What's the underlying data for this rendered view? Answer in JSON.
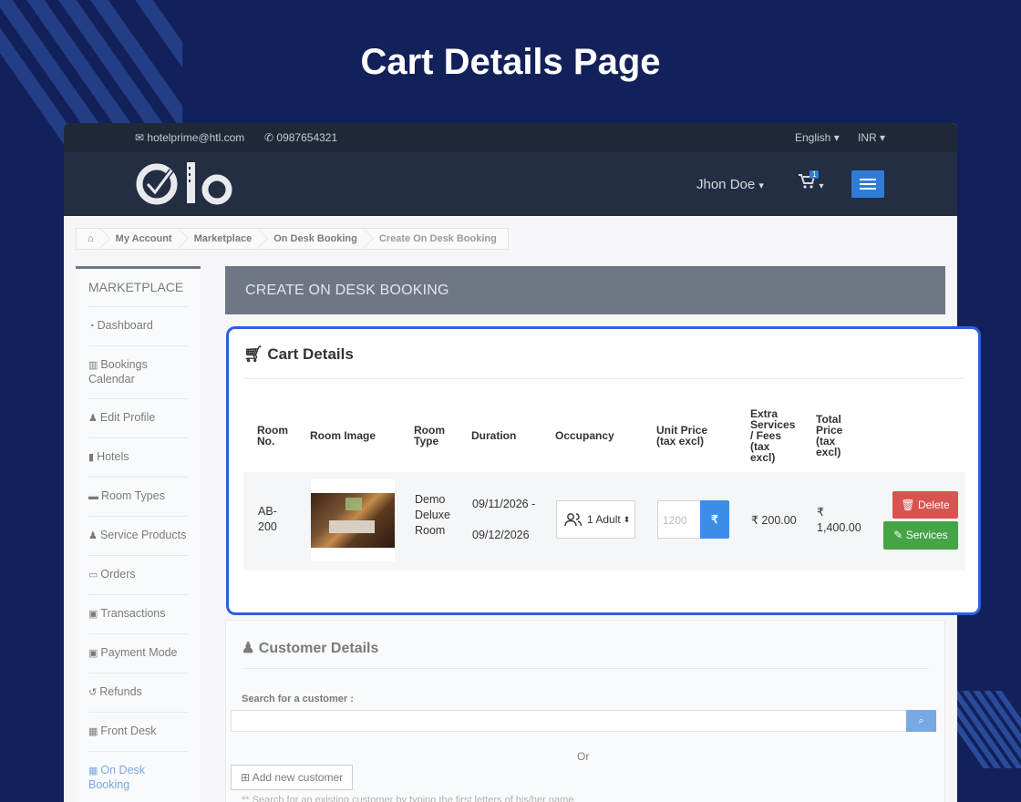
{
  "page_heading": "Cart Details Page",
  "topbar": {
    "email": "hotelprime@htl.com",
    "phone": "0987654321",
    "language": "English",
    "currency": "INR"
  },
  "navbar": {
    "user": "Jhon Doe",
    "cart_count": "1"
  },
  "breadcrumb": [
    "My Account",
    "Marketplace",
    "On Desk Booking",
    "Create On Desk Booking"
  ],
  "sidebar": {
    "title": "MARKETPLACE",
    "items": [
      {
        "label": "Dashboard",
        "icon": "dashboard-icon"
      },
      {
        "label": "Bookings Calendar",
        "icon": "bar-chart-icon"
      },
      {
        "label": "Edit Profile",
        "icon": "user-icon"
      },
      {
        "label": "Hotels",
        "icon": "building-icon"
      },
      {
        "label": "Room Types",
        "icon": "bed-icon"
      },
      {
        "label": "Service Products",
        "icon": "user-plus-icon"
      },
      {
        "label": "Orders",
        "icon": "credit-card-icon"
      },
      {
        "label": "Transactions",
        "icon": "money-icon"
      },
      {
        "label": "Payment Mode",
        "icon": "money-icon"
      },
      {
        "label": "Refunds",
        "icon": "undo-icon"
      },
      {
        "label": "Front Desk",
        "icon": "calendar-icon"
      },
      {
        "label": "On Desk Booking",
        "icon": "calendar-icon",
        "active": true
      }
    ]
  },
  "content_header": "CREATE ON DESK BOOKING",
  "cart": {
    "title": "Cart Details",
    "columns": {
      "room_no": "Room No.",
      "room_image": "Room Image",
      "room_type": "Room Type",
      "duration": "Duration",
      "occupancy": "Occupancy",
      "unit_price": "Unit Price (tax excl)",
      "extra": "Extra Services / Fees (tax excl)",
      "total": "Total Price (tax excl)"
    },
    "row": {
      "room_no": "AB-200",
      "room_type": "Demo Deluxe Room",
      "date_from": "09/11/2026 -",
      "date_to": "09/12/2026",
      "occupancy": "1 Adult",
      "unit_price_placeholder": "1200",
      "currency_symbol": "₹",
      "extra": "₹ 200.00",
      "total": "₹ 1,400.00",
      "delete_label": "Delete",
      "services_label": "Services"
    }
  },
  "customer": {
    "title": "Customer Details",
    "search_label": "Search for a customer :",
    "or": "Or",
    "add_label": "Add new customer",
    "hint": "** Search for an existing customer by typing the first letters of his/her name."
  }
}
